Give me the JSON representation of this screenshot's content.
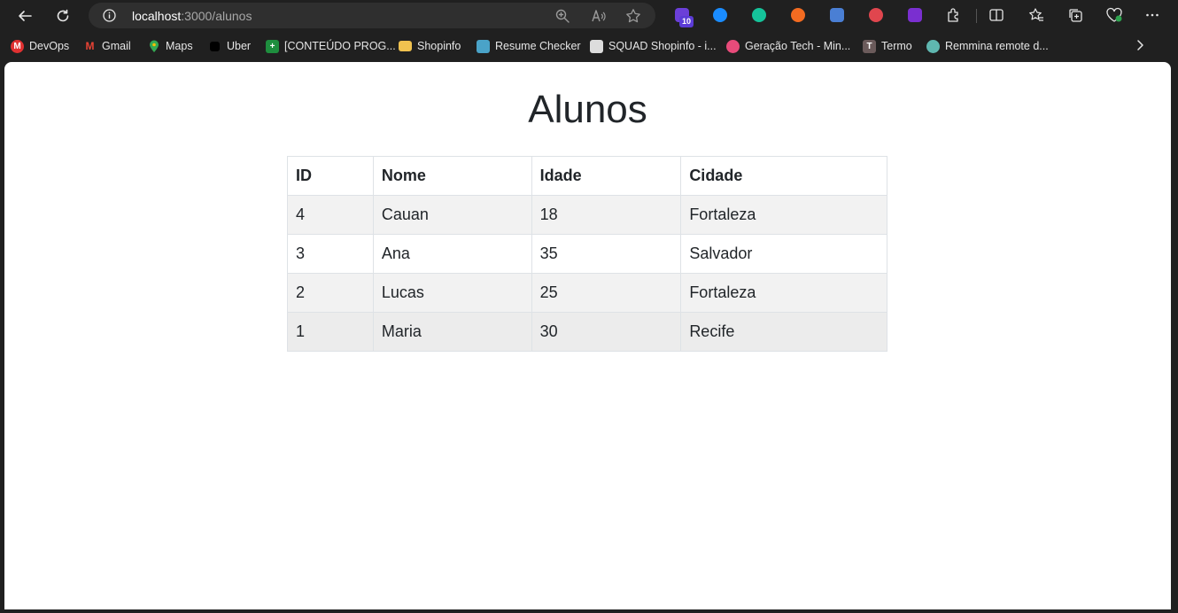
{
  "browser": {
    "url_host": "localhost",
    "url_path": ":3000/alunos",
    "extension_badge": "10"
  },
  "bookmarks": [
    {
      "label": "DevOps",
      "icon": "devops-icon",
      "color": "#e03131"
    },
    {
      "label": "Gmail",
      "icon": "gmail-icon",
      "color": "#ea4335"
    },
    {
      "label": "Maps",
      "icon": "maps-icon",
      "color": "#34a853"
    },
    {
      "label": "Uber",
      "icon": "uber-icon",
      "color": "#000000"
    },
    {
      "label": "[CONTEÚDO PROG...",
      "icon": "sheets-icon",
      "color": "#1e8e3e"
    },
    {
      "label": "Shopinfo",
      "icon": "folder-icon",
      "color": "#f0c24f"
    },
    {
      "label": "Resume Checker",
      "icon": "resume-checker-icon",
      "color": "#4aa3c8"
    },
    {
      "label": "SQUAD Shopinfo - i...",
      "icon": "squad-icon",
      "color": "#dddddd"
    },
    {
      "label": "Geração Tech - Min...",
      "icon": "geracao-tech-icon",
      "color": "#e84b7a"
    },
    {
      "label": "Termo",
      "icon": "termo-icon",
      "color": "#6b5b5b"
    },
    {
      "label": "Remmina remote d...",
      "icon": "remmina-icon",
      "color": "#5fb7b0"
    }
  ],
  "page": {
    "title": "Alunos",
    "table": {
      "headers": [
        "ID",
        "Nome",
        "Idade",
        "Cidade"
      ],
      "rows": [
        {
          "id": "4",
          "nome": "Cauan",
          "idade": "18",
          "cidade": "Fortaleza"
        },
        {
          "id": "3",
          "nome": "Ana",
          "idade": "35",
          "cidade": "Salvador"
        },
        {
          "id": "2",
          "nome": "Lucas",
          "idade": "25",
          "cidade": "Fortaleza"
        },
        {
          "id": "1",
          "nome": "Maria",
          "idade": "30",
          "cidade": "Recife"
        }
      ]
    }
  }
}
